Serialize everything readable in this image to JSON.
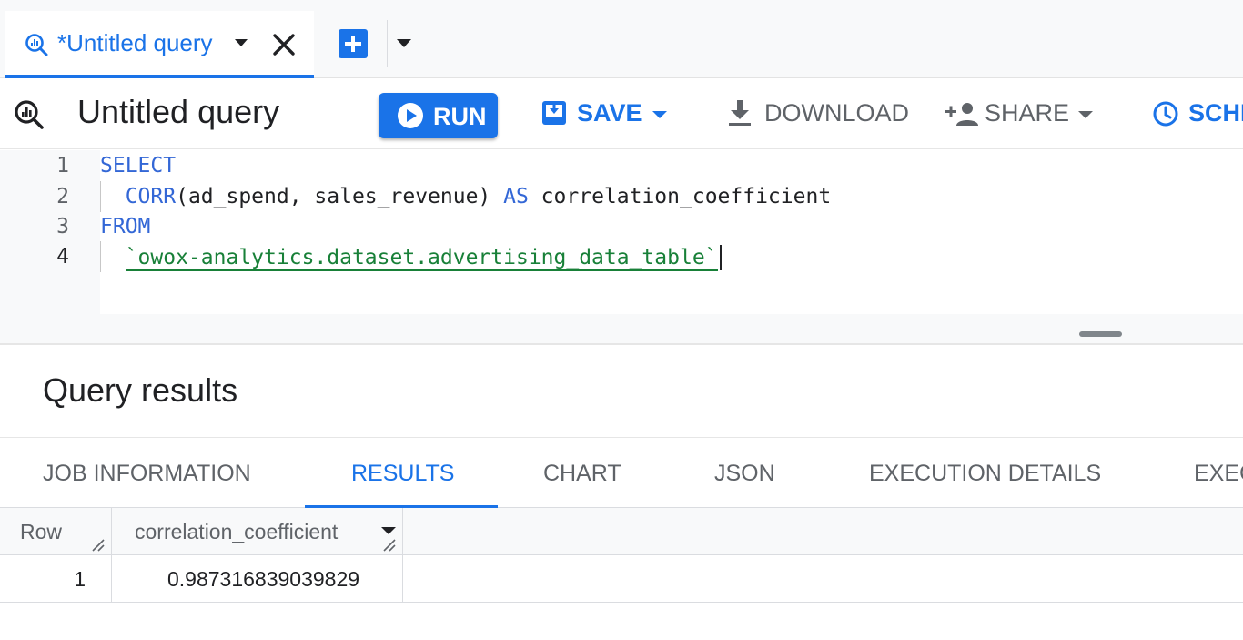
{
  "tabstrip": {
    "tab_title": "*Untitled query",
    "icons": {
      "query": "query-search-icon",
      "caret": "caret-down-icon",
      "close": "close-icon",
      "new_tab": "add-tab-icon",
      "menu": "caret-down-icon"
    }
  },
  "toolbar": {
    "title": "Untitled query",
    "run_label": "RUN",
    "save_label": "SAVE",
    "download_label": "DOWNLOAD",
    "share_label": "SHARE",
    "schedule_label": "SCHE"
  },
  "editor": {
    "lines": [
      {
        "number": "1",
        "indent": "",
        "keyword": "SELECT",
        "text": "",
        "string": ""
      },
      {
        "number": "2",
        "indent": "  ",
        "keyword": "CORR",
        "text": "(ad_spend, sales_revenue) ",
        "keyword2": "AS",
        "text2": " correlation_coefficient",
        "string": ""
      },
      {
        "number": "3",
        "indent": "",
        "keyword": "FROM",
        "text": "",
        "string": ""
      },
      {
        "number": "4",
        "indent": "  ",
        "keyword": "",
        "text": "",
        "string": "`owox-analytics.dataset.advertising_data_table`"
      }
    ]
  },
  "results": {
    "title": "Query results",
    "tabs": [
      "JOB INFORMATION",
      "RESULTS",
      "CHART",
      "JSON",
      "EXECUTION DETAILS",
      "EXEC"
    ],
    "active_tab": "RESULTS",
    "columns": [
      "Row",
      "correlation_coefficient"
    ],
    "rows": [
      [
        "1",
        "0.987316839039829"
      ]
    ]
  },
  "colors": {
    "accent": "#1a73e8",
    "keyword": "#3367d6",
    "string": "#188038",
    "muted": "#5f6368"
  }
}
